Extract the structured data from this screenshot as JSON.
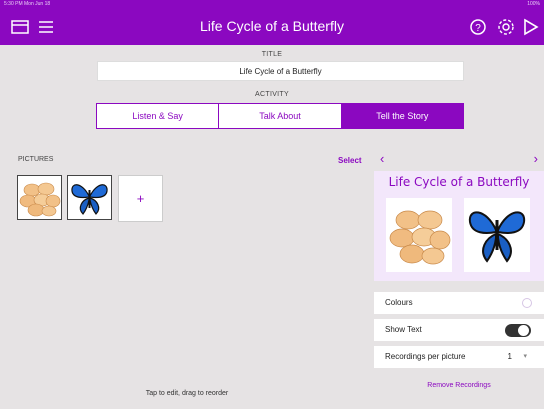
{
  "status_bar": {
    "left_text": "5:30 PM  Mon Jun 18",
    "right_text": "100%"
  },
  "header": {
    "title": "Life Cycle of a Butterfly",
    "icons": [
      "folder-icon",
      "menu-icon",
      "help-icon",
      "gear-icon",
      "play-icon"
    ]
  },
  "form": {
    "title_label": "TITLE",
    "title_value": "Life Cycle of a Butterfly",
    "activity_label": "ACTIVITY",
    "activity_options": [
      "Listen & Say",
      "Talk About",
      "Tell the Story"
    ],
    "activity_selected": "Tell the Story"
  },
  "pictures": {
    "label": "PICTURES",
    "select_label": "Select",
    "items": [
      "eggs",
      "butterfly"
    ],
    "add_symbol": "+",
    "hint": "Tap to edit, drag to reorder"
  },
  "preview": {
    "prev_symbol": "‹",
    "next_symbol": "›",
    "title": "Life Cycle of a Butterfly"
  },
  "settings": {
    "colours_label": "Colours",
    "show_text_label": "Show Text",
    "show_text_on": false,
    "recordings_label": "Recordings per picture",
    "recordings_value": "1",
    "remove_label": "Remove Recordings"
  },
  "colors": {
    "accent": "#8b08c0",
    "background": "#e6e3e4",
    "preview_bg": "#f3e7fb"
  }
}
